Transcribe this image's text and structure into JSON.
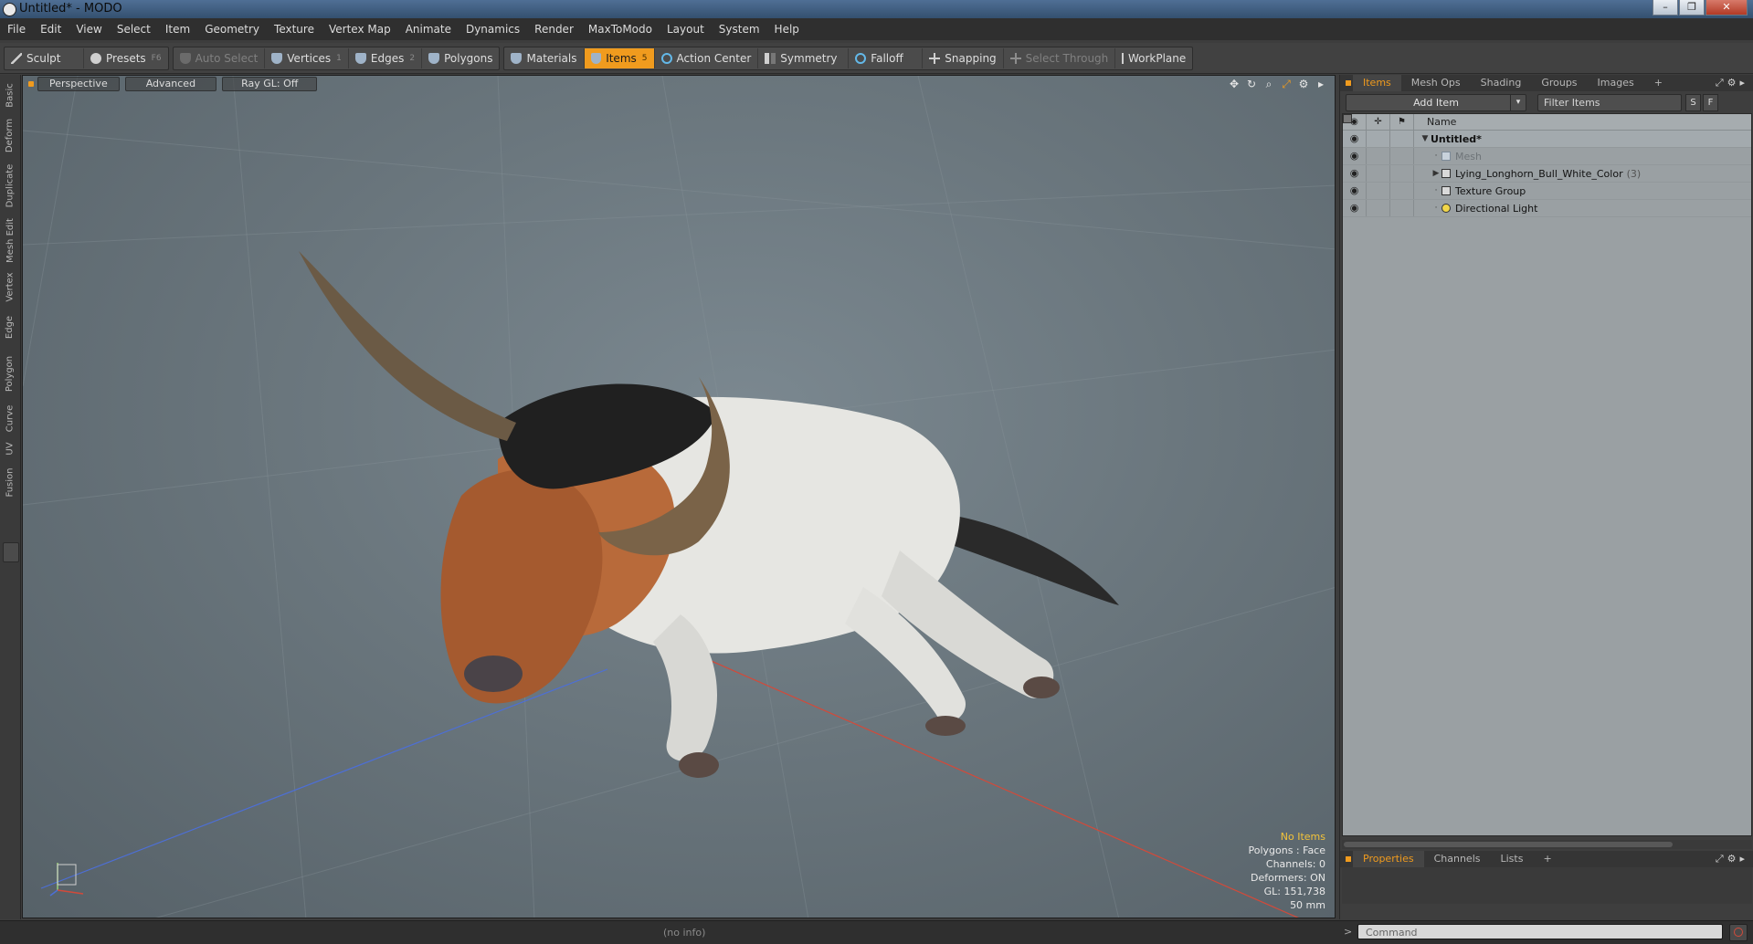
{
  "window": {
    "title": "Untitled* - MODO",
    "buttons": [
      "–",
      "❐",
      "✕"
    ]
  },
  "menu": [
    "File",
    "Edit",
    "View",
    "Select",
    "Item",
    "Geometry",
    "Texture",
    "Vertex Map",
    "Animate",
    "Dynamics",
    "Render",
    "MaxToModo",
    "Layout",
    "System",
    "Help"
  ],
  "toolbar": {
    "sculpt": "Sculpt",
    "presets": "Presets",
    "presets_key": "F6",
    "auto_select": "Auto Select",
    "vertices": "Vertices",
    "vertices_key": "1",
    "edges": "Edges",
    "edges_key": "2",
    "polygons": "Polygons",
    "materials": "Materials",
    "items": "Items",
    "items_key": "5",
    "action_center": "Action Center",
    "symmetry": "Symmetry",
    "falloff": "Falloff",
    "snapping": "Snapping",
    "select_through": "Select Through",
    "workplane": "WorkPlane"
  },
  "left_tabs": [
    "Basic",
    "Deform",
    "Duplicate",
    "Mesh Edit",
    "Vertex",
    "Edge",
    "Polygon",
    "Curve",
    "UV",
    "Fusion"
  ],
  "viewport": {
    "view": "Perspective",
    "mode": "Advanced",
    "raygl": "Ray GL: Off",
    "stats": {
      "no_items": "No Items",
      "polygons": "Polygons : Face",
      "channels": "Channels: 0",
      "deformers": "Deformers: ON",
      "gl": "GL: 151,738",
      "focal": "50 mm"
    }
  },
  "items_panel": {
    "tabs": [
      "Items",
      "Mesh Ops",
      "Shading",
      "Groups",
      "Images",
      "+"
    ],
    "add_item": "Add Item",
    "filter_placeholder": "Filter Items",
    "btn_s": "S",
    "btn_f": "F",
    "col_name": "Name",
    "tree": [
      {
        "label": "Untitled*",
        "icon": "scene-icon"
      },
      {
        "label": "Mesh",
        "icon": "mesh-icon"
      },
      {
        "label": "Lying_Longhorn_Bull_White_Color",
        "count": "(3)",
        "icon": "group-icon"
      },
      {
        "label": "Texture Group",
        "icon": "group-icon"
      },
      {
        "label": "Directional Light",
        "icon": "light-icon"
      }
    ]
  },
  "props_panel": {
    "tabs": [
      "Properties",
      "Channels",
      "Lists",
      "+"
    ]
  },
  "status": {
    "info": "(no info)",
    "command_placeholder": "Command"
  },
  "colors": {
    "accent": "#f09b1e",
    "viewport_bg": "#6a767d",
    "tree_bg": "#9aa0a3"
  }
}
